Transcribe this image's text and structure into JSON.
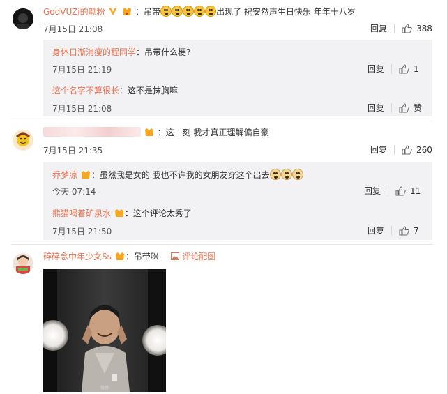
{
  "comments": [
    {
      "user": "GodVUZi的颜粉",
      "text_pre": "：吊带",
      "text_post": "出现了 祝安然声生日快乐 年年十八岁",
      "time": "7月15日 21:08",
      "reply_label": "回复",
      "likes": "388",
      "replies": [
        {
          "user": "身体日渐消瘦的程同学",
          "text": "：吊带什么梗?",
          "time": "7月15日 21:19",
          "reply_label": "回复",
          "likes": "1"
        },
        {
          "user": "这个名字不算很长",
          "text": "：这不是抹胸嘛",
          "time": "7月15日 21:08",
          "reply_label": "回复",
          "likes": "赞"
        }
      ]
    },
    {
      "user": "",
      "text": "：这一刻 我才真正理解偏自豪",
      "time": "7月15日 21:35",
      "reply_label": "回复",
      "likes": "260",
      "replies": [
        {
          "user": "乔梦凉",
          "text": "：虽然我是女的 我也不许我的女朋友穿这个出去",
          "time": "今天 07:14",
          "reply_label": "回复",
          "likes": "11"
        },
        {
          "user": "熊猫喝着矿泉水",
          "text": "：这个评论太秀了",
          "time": "7月15日 21:50",
          "reply_label": "回复",
          "likes": "7"
        }
      ]
    },
    {
      "user": "碎碎念中年少女Ss",
      "text": "：吊带咪",
      "image_link": "评论配图"
    }
  ],
  "colors": {
    "username": "#eb7350",
    "reply_bg": "#f2f2f5"
  }
}
